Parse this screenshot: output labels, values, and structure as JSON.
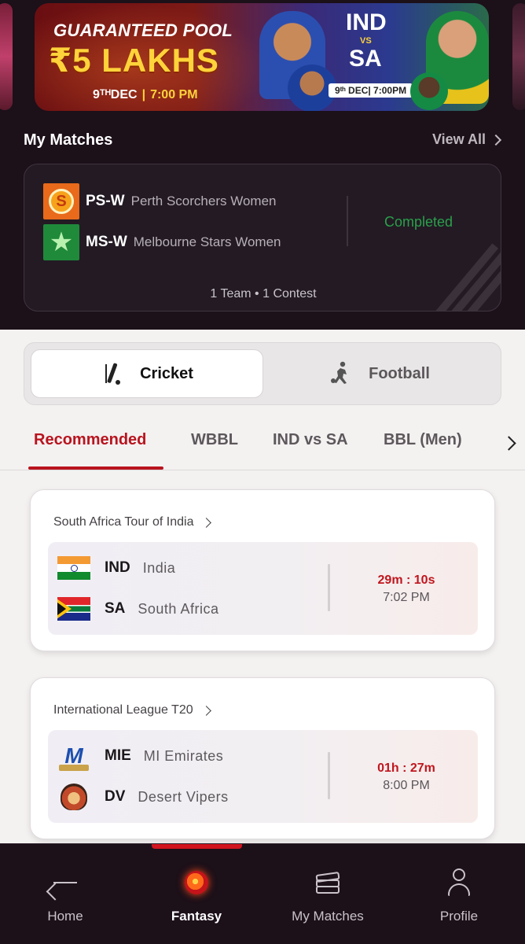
{
  "banner": {
    "title": "GUARANTEED POOL",
    "amount": "₹5 LAKHS",
    "date": "9ᵀᴴDEC",
    "time": "7:00 PM",
    "team_a": "IND",
    "vs": "VS",
    "team_b": "SA",
    "date_time_badge": "9ᵗʰ DEC| 7:00PM"
  },
  "my_matches": {
    "heading": "My Matches",
    "view_all": "View All",
    "teams": [
      {
        "code": "PS-W",
        "name": "Perth Scorchers Women",
        "logo": "ps-logo"
      },
      {
        "code": "MS-W",
        "name": "Melbourne Stars Women",
        "logo": "ms-logo"
      }
    ],
    "status": "Completed",
    "footer": "1 Team  •  1 Contest",
    "colors": {
      "completed": "#2aa04a"
    }
  },
  "sport_toggle": {
    "cricket": "Cricket",
    "football": "Football"
  },
  "tabs": [
    {
      "label": "Recommended",
      "active": true
    },
    {
      "label": "WBBL"
    },
    {
      "label": "IND vs SA"
    },
    {
      "label": "BBL (Men)"
    }
  ],
  "matches": [
    {
      "series": "South Africa Tour of India",
      "team_a": {
        "code": "IND",
        "name": "India"
      },
      "team_b": {
        "code": "SA",
        "name": "South Africa"
      },
      "countdown": "29m : 10s",
      "start_time": "7:02 PM"
    },
    {
      "series": "International League T20",
      "team_a": {
        "code": "MIE",
        "name": "MI Emirates"
      },
      "team_b": {
        "code": "DV",
        "name": "Desert Vipers"
      },
      "countdown": "01h : 27m",
      "start_time": "8:00 PM"
    }
  ],
  "nav": [
    {
      "label": "Home",
      "icon": "back-arrow-icon"
    },
    {
      "label": "Fantasy",
      "icon": "fireball-icon",
      "active": true
    },
    {
      "label": "My Matches",
      "icon": "tickets-icon"
    },
    {
      "label": "Profile",
      "icon": "person-icon"
    }
  ],
  "colors": {
    "accent": "#b8141e",
    "dark_bg": "#1c1019",
    "light_bg": "#f4f1f1"
  }
}
